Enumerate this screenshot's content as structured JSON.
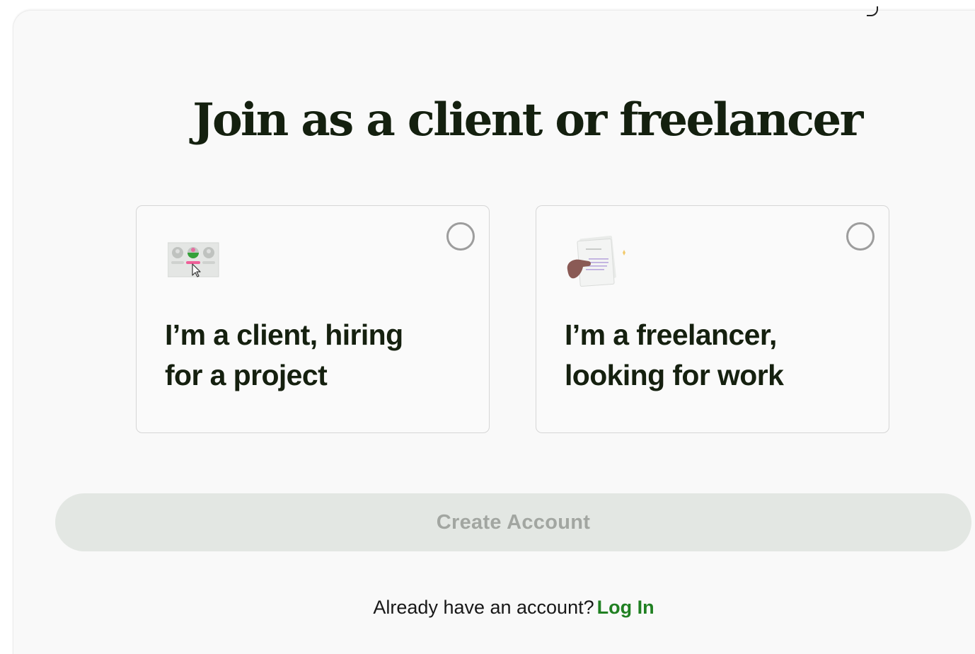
{
  "page": {
    "title": "Join as a client or freelancer"
  },
  "options": [
    {
      "label_line1": "I’m a client, hiring",
      "label_line2": "for a project",
      "icon": "hiring-board-illustration",
      "selected": false
    },
    {
      "label_line1": "I’m a freelancer,",
      "label_line2": "looking for work",
      "icon": "document-in-hand-illustration",
      "selected": false
    }
  ],
  "create_button": {
    "label": "Create Account",
    "disabled": true
  },
  "login": {
    "prompt": "Already have an account?",
    "link_label": "Log In"
  },
  "colors": {
    "heading": "#14200f",
    "link": "#208022",
    "button_disabled_bg": "#e3e7e3",
    "button_disabled_text": "#a2a6a1",
    "radio_border": "#9d9d9d"
  }
}
